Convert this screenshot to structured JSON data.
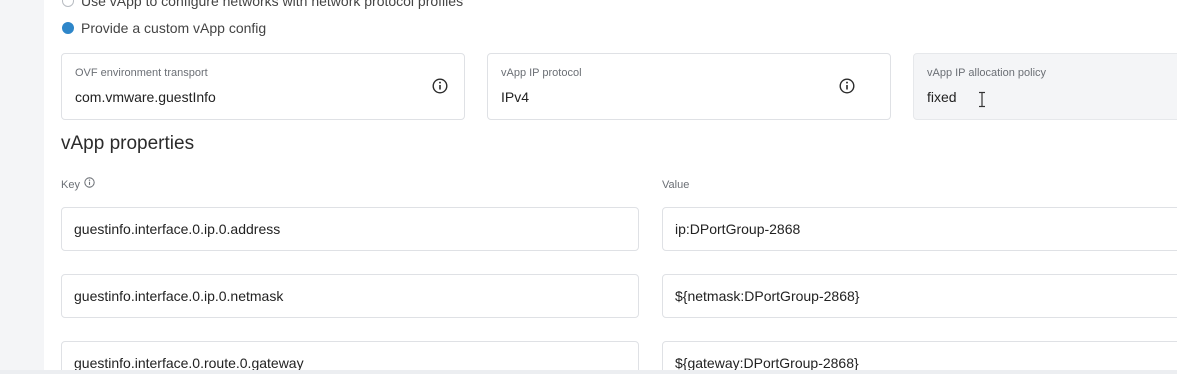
{
  "network_options": {
    "protocol_profiles_label": "Use vApp to configure networks with network protocol profiles",
    "custom_config_label": "Provide a custom vApp config",
    "selected": "custom"
  },
  "config_fields": [
    {
      "label": "OVF environment transport",
      "value": "com.vmware.guestInfo",
      "icon": "info-icon"
    },
    {
      "label": "vApp IP protocol",
      "value": "IPv4",
      "icon": "info-icon"
    },
    {
      "label": "vApp IP allocation policy",
      "value": "fixed",
      "disabled": true
    }
  ],
  "properties": {
    "title": "vApp properties",
    "key_header": "Key",
    "value_header": "Value",
    "rows": [
      {
        "key": "guestinfo.interface.0.ip.0.address",
        "value": "ip:DPortGroup-2868"
      },
      {
        "key": "guestinfo.interface.0.ip.0.netmask",
        "value": "${netmask:DPortGroup-2868}"
      },
      {
        "key": "guestinfo.interface.0.route.0.gateway",
        "value": "${gateway:DPortGroup-2868}"
      }
    ]
  },
  "colors": {
    "accent": "#2e86c9",
    "border": "#dfe1e5",
    "muted_text": "#6b6f75"
  }
}
